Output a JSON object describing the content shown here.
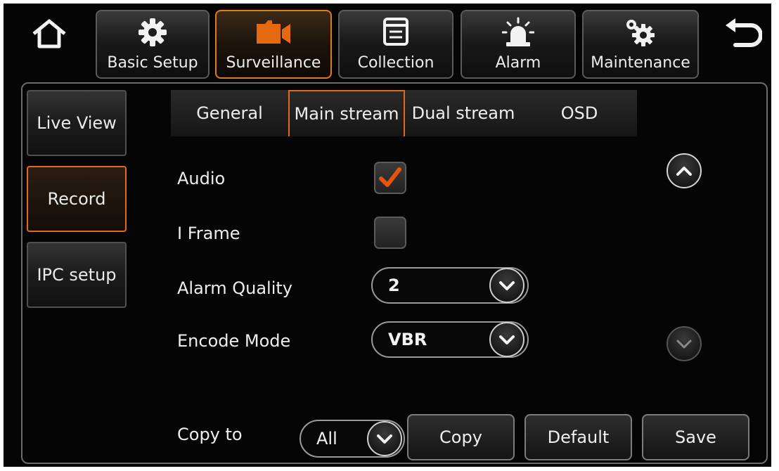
{
  "nav": {
    "items": [
      {
        "label": "Basic Setup",
        "icon": "gear-icon"
      },
      {
        "label": "Surveillance",
        "icon": "camera-icon"
      },
      {
        "label": "Collection",
        "icon": "document-icon"
      },
      {
        "label": "Alarm",
        "icon": "alarm-light-icon"
      },
      {
        "label": "Maintenance",
        "icon": "gears-icon"
      }
    ],
    "active": "Surveillance",
    "accent_color": "#e07a1a"
  },
  "sidebar": {
    "items": [
      {
        "label": "Live View"
      },
      {
        "label": "Record"
      },
      {
        "label": "IPC setup"
      }
    ],
    "active": "Record"
  },
  "tabs": {
    "items": [
      {
        "label": "General"
      },
      {
        "label": "Main stream"
      },
      {
        "label": "Dual stream"
      },
      {
        "label": "OSD"
      }
    ],
    "active": "Main stream"
  },
  "form": {
    "audio": {
      "label": "Audio",
      "checked": true
    },
    "iframe": {
      "label": "I Frame",
      "checked": false
    },
    "alarm_quality": {
      "label": "Alarm Quality",
      "value": "2"
    },
    "encode_mode": {
      "label": "Encode Mode",
      "value": "VBR"
    }
  },
  "footer": {
    "copy_to_label": "Copy to",
    "copy_to_value": "All",
    "copy_button": "Copy",
    "default_button": "Default",
    "save_button": "Save"
  }
}
